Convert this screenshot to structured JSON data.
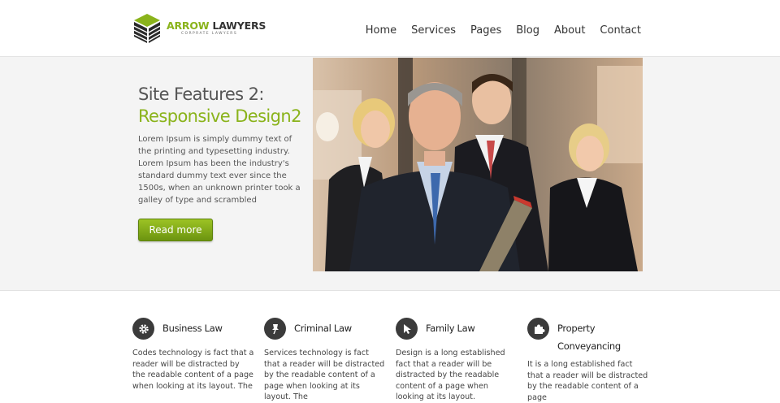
{
  "brand": {
    "name_green": "ARROW",
    "name_dark": " LAWYERS",
    "tagline": "CORPRATE LAWYERS",
    "accent_color": "#8ab31b"
  },
  "nav": {
    "items": [
      "Home",
      "Services",
      "Pages",
      "Blog",
      "About",
      "Contact"
    ]
  },
  "hero": {
    "title_line1": "Site Features 2:",
    "title_line2": "Responsive Design2",
    "text": "Lorem Ipsum is simply dummy text of the printing and typesetting industry. Lorem Ipsum has been the industry's standard dummy text ever since the 1500s, when an unknown printer took a galley of type and scrambled",
    "button_label": "Read more"
  },
  "services": [
    {
      "title": "Business Law",
      "icon": "gear-icon",
      "text": "Codes technology is fact that a reader will be distracted by the readable content of a page when looking at its layout. The"
    },
    {
      "title": "Criminal Law",
      "icon": "pushpin-icon",
      "text": "Services technology is fact that a reader will be distracted by the readable content of a page when looking at its layout. The"
    },
    {
      "title": "Family Law",
      "icon": "cursor-icon",
      "text": "Design is a long established fact that a reader will be distracted by the readable content of a page when looking at its layout."
    },
    {
      "title": "Property Conveyancing",
      "icon": "puzzle-icon",
      "text": "It is a long established fact that a reader will be distracted by the readable content of a page"
    }
  ]
}
